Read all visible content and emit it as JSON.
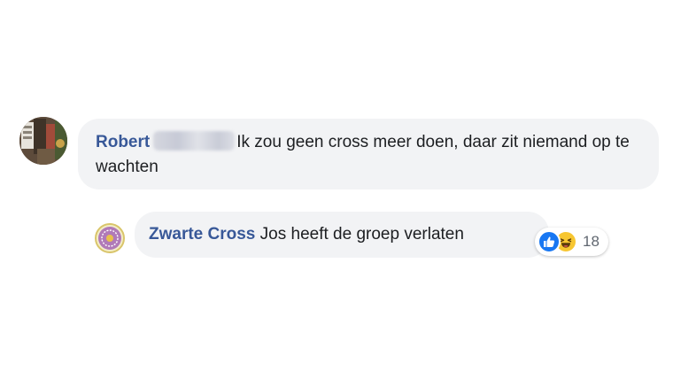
{
  "comments": [
    {
      "author": "Robert",
      "author_lastname_blurred": true,
      "text": "Ik zou geen cross meer doen, daar zit niemand op te wachten"
    },
    {
      "author": "Zwarte Cross",
      "text": "Jos heeft de groep verlaten",
      "reactions": {
        "icons": [
          "like-icon",
          "haha-icon"
        ],
        "count": "18"
      }
    }
  ],
  "colors": {
    "author_link": "#385898",
    "bubble_bg": "#f2f3f5",
    "like_blue": "#1877f2",
    "haha_yellow": "#f7c631",
    "text": "#1c1e21"
  }
}
